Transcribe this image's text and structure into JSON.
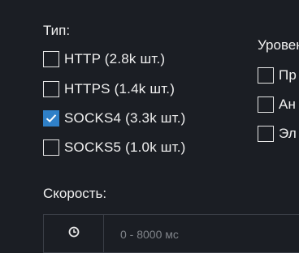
{
  "filters": {
    "type_title": "Тип:",
    "types": [
      {
        "label": "HTTP (2.8k шт.)",
        "checked": false
      },
      {
        "label": "HTTPS (1.4k шт.)",
        "checked": false
      },
      {
        "label": "SOCKS4 (3.3k шт.)",
        "checked": true
      },
      {
        "label": "SOCKS5 (1.0k шт.)",
        "checked": false
      }
    ],
    "level_title": "Уровен",
    "levels": [
      {
        "label": "Пр",
        "checked": false
      },
      {
        "label": "Ан",
        "checked": false
      },
      {
        "label": "Эл",
        "checked": false
      }
    ],
    "speed_title": "Скорость:",
    "speed_placeholder": "0 - 8000 мс",
    "speed_icon": "clock-icon"
  },
  "colors": {
    "background": "#1b1e24",
    "checkbox_checked": "#2f80c8",
    "text": "#f0f0f0",
    "input_border": "#3a3e46"
  }
}
